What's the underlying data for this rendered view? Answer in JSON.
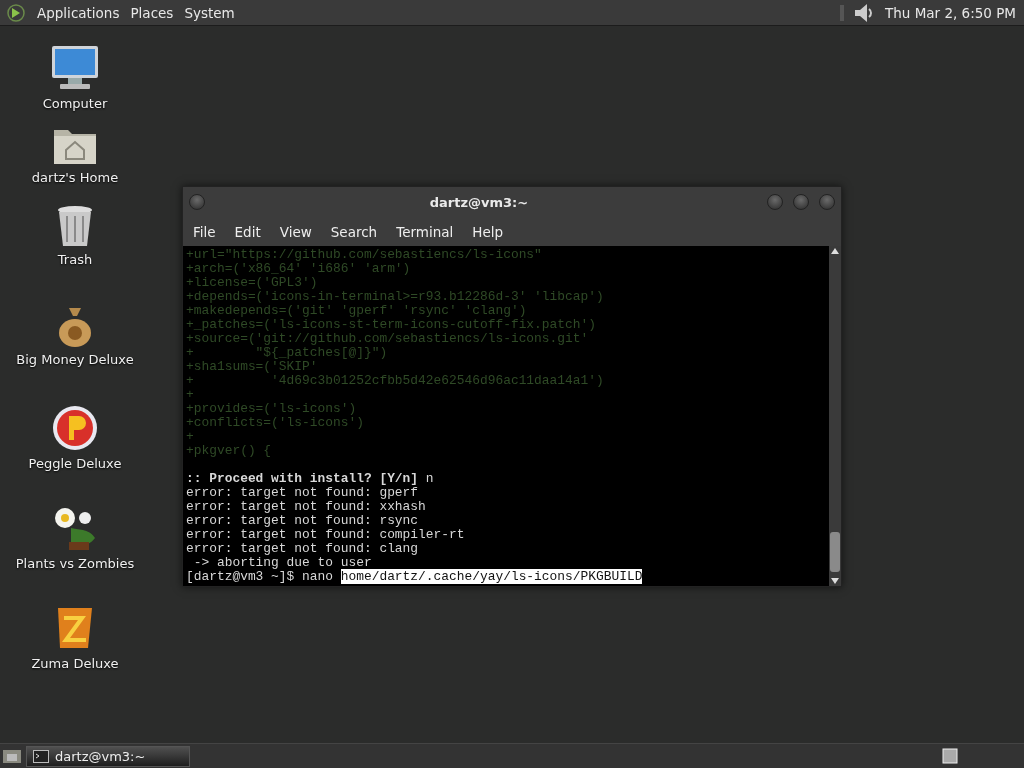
{
  "top_panel": {
    "menus": [
      "Applications",
      "Places",
      "System"
    ],
    "clock": "Thu Mar  2,  6:50 PM"
  },
  "desktop": {
    "places": [
      {
        "label": "Computer",
        "kind": "computer"
      },
      {
        "label": "dartz's Home",
        "kind": "home"
      },
      {
        "label": "Trash",
        "kind": "trash"
      }
    ],
    "apps": [
      {
        "label": "Big Money Deluxe",
        "kind": "money"
      },
      {
        "label": "Peggle Deluxe",
        "kind": "peggle"
      },
      {
        "label": "Plants vs Zombies",
        "kind": "plants"
      },
      {
        "label": "Zuma Deluxe",
        "kind": "zuma"
      }
    ]
  },
  "terminal": {
    "title": "dartz@vm3:~",
    "menu": [
      "File",
      "Edit",
      "View",
      "Search",
      "Terminal",
      "Help"
    ],
    "lines": [
      {
        "kind": "diff",
        "text": "+url=\"https://github.com/sebastiencs/ls-icons\""
      },
      {
        "kind": "diff",
        "text": "+arch=('x86_64' 'i686' 'arm')"
      },
      {
        "kind": "diff",
        "text": "+license=('GPL3')"
      },
      {
        "kind": "diff",
        "text": "+depends=('icons-in-terminal>=r93.b12286d-3' 'libcap')"
      },
      {
        "kind": "diff",
        "text": "+makedepends=('git' 'gperf' 'rsync' 'clang')"
      },
      {
        "kind": "diff",
        "text": "+_patches=('ls-icons-st-term-icons-cutoff-fix.patch')"
      },
      {
        "kind": "diff",
        "text": "+source=('git://github.com/sebastiencs/ls-icons.git'"
      },
      {
        "kind": "diff",
        "text": "+        \"${_patches[@]}\")"
      },
      {
        "kind": "diff",
        "text": "+sha1sums=('SKIP'"
      },
      {
        "kind": "diff",
        "text": "+          '4d69c3b01252cfbb5d42e62546d96ac11daa14a1')"
      },
      {
        "kind": "diff",
        "text": "+"
      },
      {
        "kind": "diff",
        "text": "+provides=('ls-icons')"
      },
      {
        "kind": "diff",
        "text": "+conflicts=('ls-icons')"
      },
      {
        "kind": "diff",
        "text": "+"
      },
      {
        "kind": "diff",
        "text": "+pkgver() {"
      },
      {
        "kind": "blank"
      },
      {
        "kind": "plain",
        "text": "**:: Proceed with install? [Y/n]** n"
      },
      {
        "kind": "plain",
        "text": "error: target not found: gperf"
      },
      {
        "kind": "plain",
        "text": "error: target not found: xxhash"
      },
      {
        "kind": "plain",
        "text": "error: target not found: rsync"
      },
      {
        "kind": "plain",
        "text": "error: target not found: compiler-rt"
      },
      {
        "kind": "plain",
        "text": "error: target not found: clang"
      },
      {
        "kind": "plain",
        "text": " -> aborting due to user"
      },
      {
        "kind": "prompt",
        "text": "[dartz@vm3 ~]$ nano ",
        "selection": "home/dartz/.cache/yay/ls-icons/PKGBUILD"
      }
    ]
  },
  "taskbar": {
    "tasks": [
      {
        "label": "dartz@vm3:~",
        "selected": true
      }
    ]
  }
}
